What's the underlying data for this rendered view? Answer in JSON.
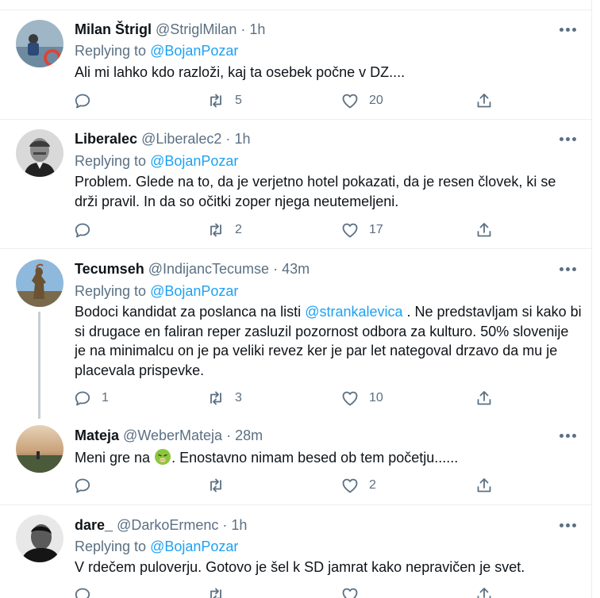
{
  "colors": {
    "accent": "#1da1f2",
    "secondary_text": "#5b7083",
    "border": "#ebeef0",
    "thread_line": "#c4cfd6"
  },
  "tweets": [
    {
      "name": "Milan Štrigl",
      "handle": "@StriglMilan",
      "dot": "·",
      "time": "1h",
      "replying_prefix": "Replying to",
      "replying_to": "@BojanPozar",
      "text": "Ali mi lahko kdo razloži, kaj ta osebek počne v DZ....",
      "reply_count": "",
      "retweet_count": "5",
      "like_count": "20"
    },
    {
      "name": "Liberalec",
      "handle": "@Liberalec2",
      "dot": "·",
      "time": "1h",
      "replying_prefix": "Replying to",
      "replying_to": "@BojanPozar",
      "text": "Problem. Glede na to, da je verjetno hotel pokazati, da je resen človek, ki se drži pravil. In da so očitki zoper njega neutemeljeni.",
      "reply_count": "",
      "retweet_count": "2",
      "like_count": "17"
    },
    {
      "name": "Tecumseh",
      "handle": "@IndijancTecumse",
      "dot": "·",
      "time": "43m",
      "replying_prefix": "Replying to",
      "replying_to": "@BojanPozar",
      "text_before": "Bodoci kandidat za poslanca na listi ",
      "text_mention": "@strankalevica",
      "text_after": " . Ne predstavljam si kako bi si drugace en faliran reper zasluzil pozornost odbora za kulturo. 50% slovenije je na minimalcu on je pa veliki revez ker je  par let nategoval drzavo da mu je placevala prispevke.",
      "reply_count": "1",
      "retweet_count": "3",
      "like_count": "10"
    },
    {
      "name": "Mateja",
      "handle": "@WeberMateja",
      "dot": "·",
      "time": "28m",
      "text_before": "Meni gre na ",
      "emoji_name": "nauseated-face-emoji",
      "text_after": ". Enostavno nimam besed ob tem početju......",
      "reply_count": "",
      "retweet_count": "",
      "like_count": "2"
    },
    {
      "name": "dare_",
      "handle": "@DarkoErmenc",
      "dot": "·",
      "time": "1h",
      "replying_prefix": "Replying to",
      "replying_to": "@BojanPozar",
      "text": "V rdečem puloverju. Gotovo je šel k SD jamrat kako nepravičen je svet.",
      "reply_count": "",
      "retweet_count": "",
      "like_count": ""
    }
  ],
  "icons": {
    "reply": "reply-icon",
    "retweet": "retweet-icon",
    "like": "heart-icon",
    "share": "share-icon",
    "more": "more-icon"
  }
}
